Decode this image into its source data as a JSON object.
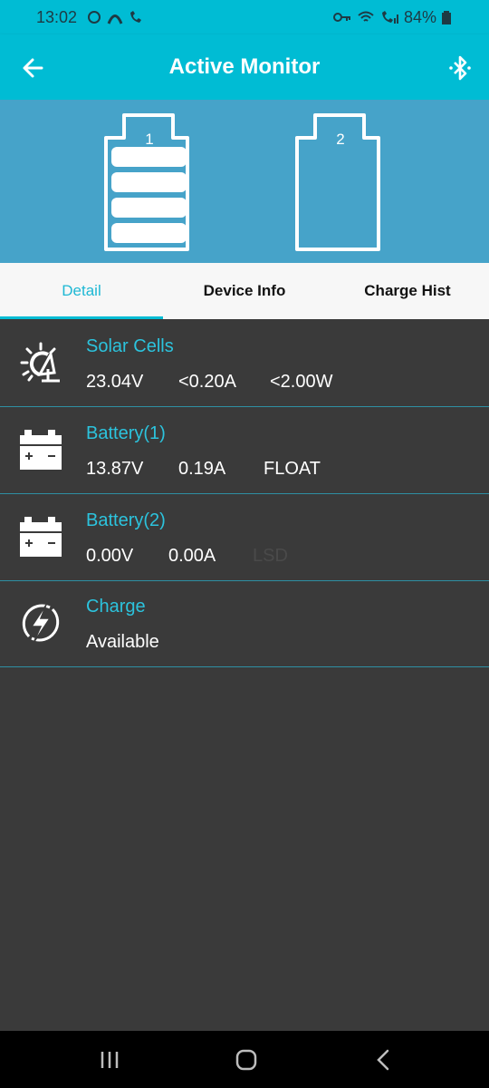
{
  "status_bar": {
    "time": "13:02",
    "battery_percent": "84%"
  },
  "app_bar": {
    "title": "Active Monitor",
    "back_icon": "arrow-left-icon",
    "bluetooth_icon": "bluetooth-icon"
  },
  "batteries": [
    {
      "number": "1",
      "fill_bars": 4
    },
    {
      "number": "2",
      "fill_bars": 0
    }
  ],
  "tabs": [
    {
      "label": "Detail",
      "active": true
    },
    {
      "label": "Device Info",
      "active": false
    },
    {
      "label": "Charge Hist",
      "active": false
    }
  ],
  "rows": {
    "solar": {
      "label": "Solar Cells",
      "icon": "solar-panel-sun-icon",
      "voltage": "23.04V",
      "current": "<0.20A",
      "power": "<2.00W"
    },
    "battery1": {
      "label": "Battery(1)",
      "icon": "car-battery-icon",
      "voltage": "13.87V",
      "current": "0.19A",
      "state": "FLOAT"
    },
    "battery2": {
      "label": "Battery(2)",
      "icon": "car-battery-icon",
      "voltage": "0.00V",
      "current": "0.00A",
      "state": "LSD"
    },
    "charge": {
      "label": "Charge",
      "icon": "lightning-icon",
      "status": "Available"
    }
  },
  "colors": {
    "accent": "#00bcd4",
    "battery_area": "#46a3c9",
    "background": "#3a3a3a",
    "label": "#2cc3dd"
  }
}
